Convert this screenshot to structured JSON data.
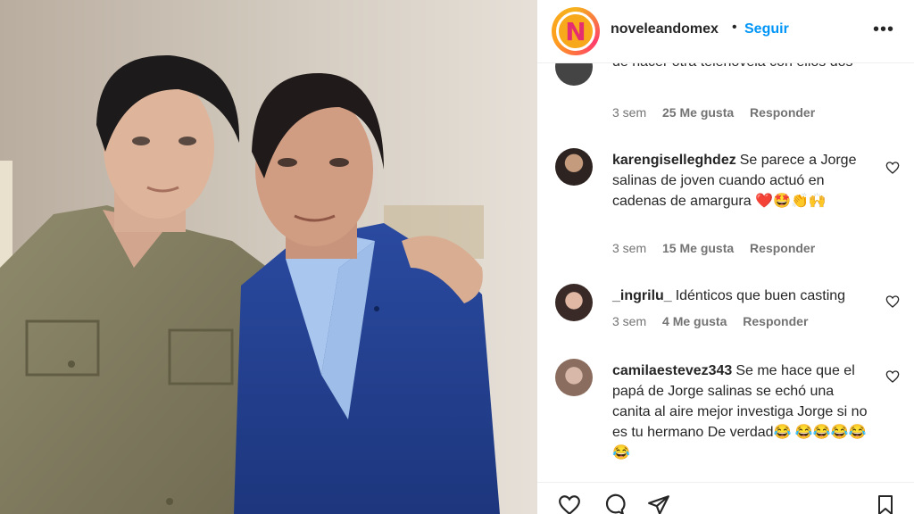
{
  "post": {
    "account": "noveleandomex",
    "separator": "•",
    "follow_label": "Seguir",
    "more_label": "•••",
    "logo_letter": "N"
  },
  "comments": [
    {
      "user": "",
      "text": "de hacer otra telenovela con ellos dos",
      "time": "3 sem",
      "likes": "25 Me gusta",
      "reply": "Responder"
    },
    {
      "user": "karengiselleghdez",
      "text": "Se parece a Jorge salinas de joven cuando actuó en cadenas de amargura ❤️🤩👏🙌",
      "time": "3 sem",
      "likes": "15 Me gusta",
      "reply": "Responder"
    },
    {
      "user": "_ingrilu_",
      "text": "Idénticos que buen casting",
      "time": "3 sem",
      "likes": "4 Me gusta",
      "reply": "Responder"
    },
    {
      "user": "camilaestevez343",
      "text": "Se me hace que el papá de Jorge salinas se echó una canita al aire mejor investiga Jorge si no es tu hermano De verdad😂 😂😂😂😂😂",
      "time": "",
      "likes": "",
      "reply": ""
    }
  ],
  "icons": [
    "heart-icon",
    "comment-icon",
    "share-icon",
    "bookmark-icon",
    "more-icon"
  ],
  "colors": {
    "accent": "#0095f6",
    "meta": "#737373",
    "text": "#262626"
  }
}
